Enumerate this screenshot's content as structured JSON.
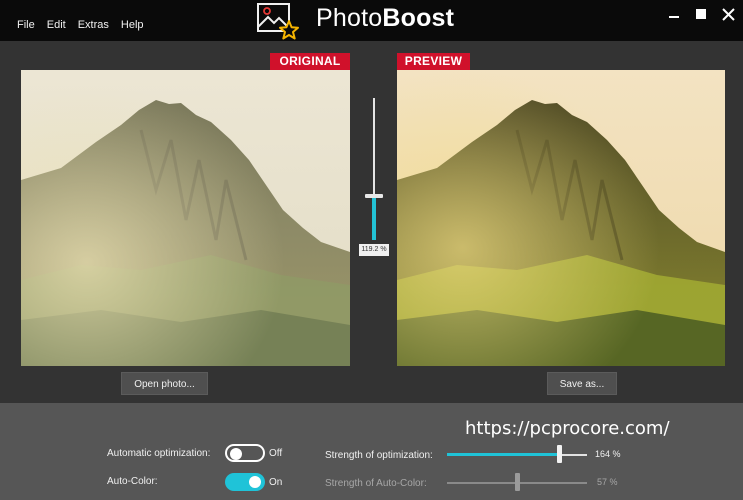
{
  "menu": {
    "file": "File",
    "edit": "Edit",
    "extras": "Extras",
    "help": "Help"
  },
  "brand": {
    "part1": "Photo",
    "part2": "Boost"
  },
  "window_controls": {
    "minimize": "minimize-icon",
    "maximize": "maximize-icon",
    "close": "close-icon"
  },
  "original": {
    "tag": "ORIGINAL",
    "open_button": "Open photo..."
  },
  "preview": {
    "tag": "PREVIEW",
    "save_button": "Save as..."
  },
  "vertical_slider": {
    "value_text": "119.2 %",
    "level": 0.31
  },
  "automatic_optimization": {
    "label": "Automatic optimization:",
    "state": "Off"
  },
  "auto_color": {
    "label": "Auto-Color:",
    "state": "On"
  },
  "strength_of_optimization": {
    "label": "Strength of optimization:",
    "value_text": "164 %",
    "level": 0.8
  },
  "strength_of_auto_color": {
    "label": "Strength of Auto-Color:",
    "value_text": "57 %",
    "level": 0.5
  },
  "watermark": "https://pcprocore.com/",
  "colors": {
    "accent": "#1fc3d8",
    "tag": "#d0112b",
    "titlebar": "#0a0a0a",
    "workarea": "#333333",
    "bottombar": "#565656"
  }
}
